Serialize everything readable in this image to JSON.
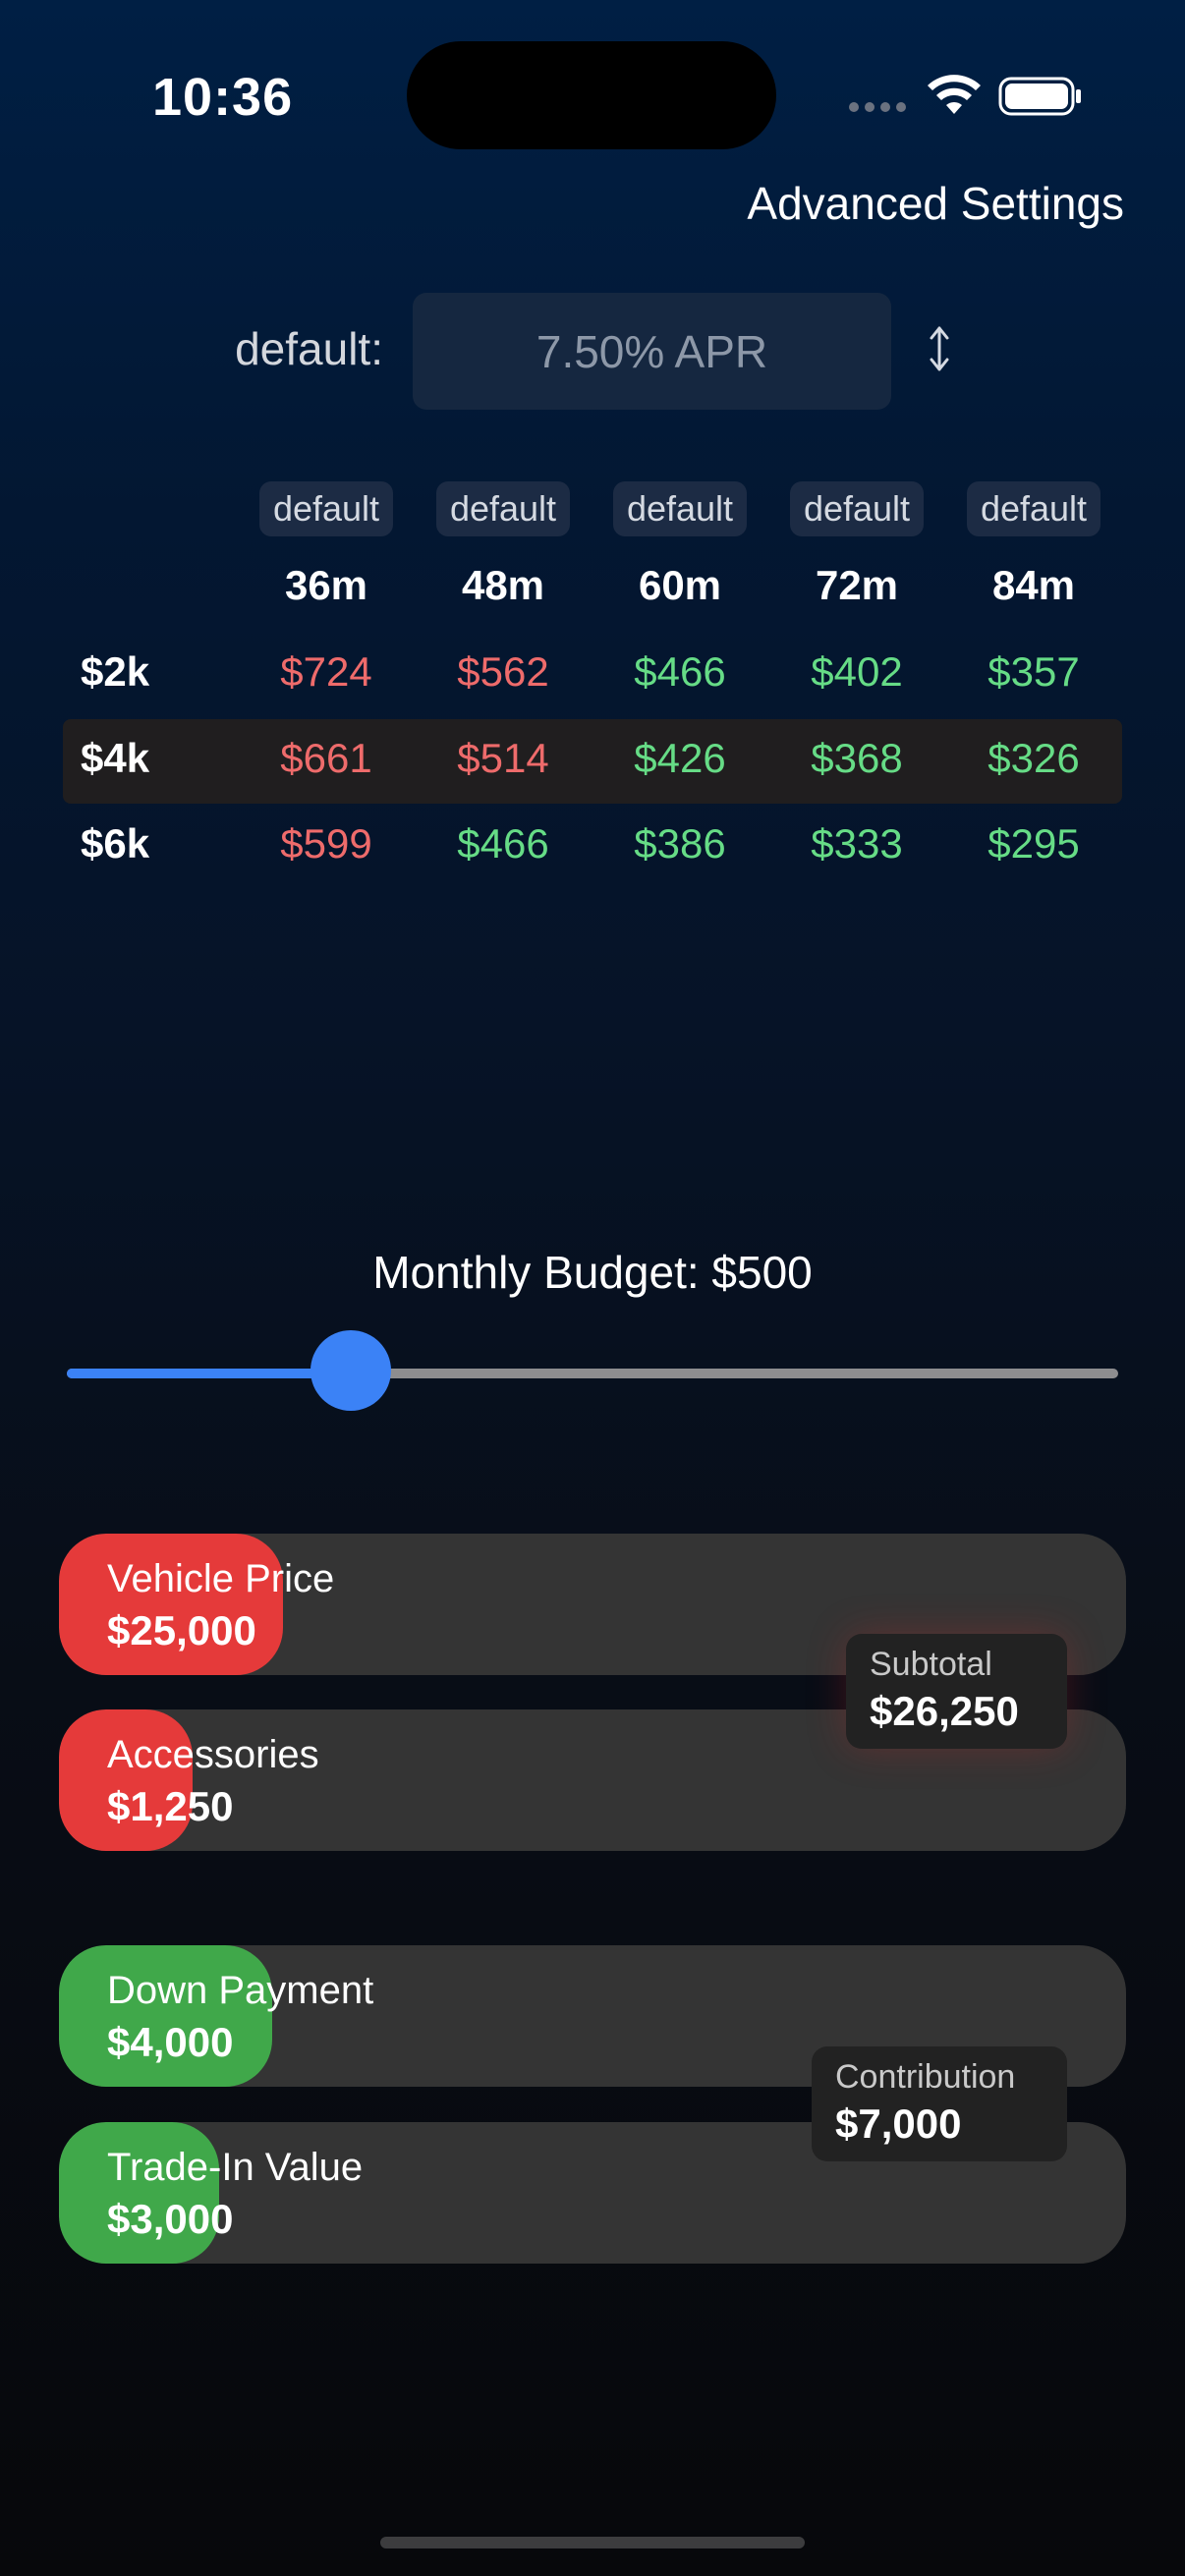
{
  "status": {
    "time": "10:36"
  },
  "header": {
    "advanced_settings": "Advanced Settings"
  },
  "apr": {
    "label": "default:",
    "placeholder": "7.50% APR"
  },
  "table": {
    "columns": [
      {
        "tag": "default",
        "term": "36m"
      },
      {
        "tag": "default",
        "term": "48m"
      },
      {
        "tag": "default",
        "term": "60m"
      },
      {
        "tag": "default",
        "term": "72m"
      },
      {
        "tag": "default",
        "term": "84m"
      }
    ],
    "rows": [
      {
        "label": "$2k",
        "highlighted": false,
        "cells": [
          {
            "value": "$724",
            "status": "red"
          },
          {
            "value": "$562",
            "status": "red"
          },
          {
            "value": "$466",
            "status": "green"
          },
          {
            "value": "$402",
            "status": "green"
          },
          {
            "value": "$357",
            "status": "green"
          }
        ]
      },
      {
        "label": "$4k",
        "highlighted": true,
        "cells": [
          {
            "value": "$661",
            "status": "red"
          },
          {
            "value": "$514",
            "status": "red"
          },
          {
            "value": "$426",
            "status": "green"
          },
          {
            "value": "$368",
            "status": "green"
          },
          {
            "value": "$326",
            "status": "green"
          }
        ]
      },
      {
        "label": "$6k",
        "highlighted": false,
        "cells": [
          {
            "value": "$599",
            "status": "red"
          },
          {
            "value": "$466",
            "status": "green"
          },
          {
            "value": "$386",
            "status": "green"
          },
          {
            "value": "$333",
            "status": "green"
          },
          {
            "value": "$295",
            "status": "green"
          }
        ]
      }
    ]
  },
  "budget": {
    "label": "Monthly Budget: $500",
    "slider_fraction": 0.27
  },
  "costs": [
    {
      "label": "Vehicle Price",
      "value": "$25,000",
      "fill_fraction": 0.21
    },
    {
      "label": "Accessories",
      "value": "$1,250",
      "fill_fraction": 0.125
    }
  ],
  "subtotal": {
    "label": "Subtotal",
    "value": "$26,250"
  },
  "contributions": [
    {
      "label": "Down Payment",
      "value": "$4,000",
      "fill_fraction": 0.2
    },
    {
      "label": "Trade-In Value",
      "value": "$3,000",
      "fill_fraction": 0.15
    }
  ],
  "contribution_total": {
    "label": "Contribution",
    "value": "$7,000"
  },
  "colors": {
    "accent": "#3b82f6",
    "negative": "#e53a3a",
    "positive": "#40a84a",
    "bar_track": "#343434"
  },
  "icons": {
    "signal": "signal-dots-icon",
    "wifi": "wifi-icon",
    "battery": "battery-icon",
    "sort": "up-down-arrow-icon"
  }
}
